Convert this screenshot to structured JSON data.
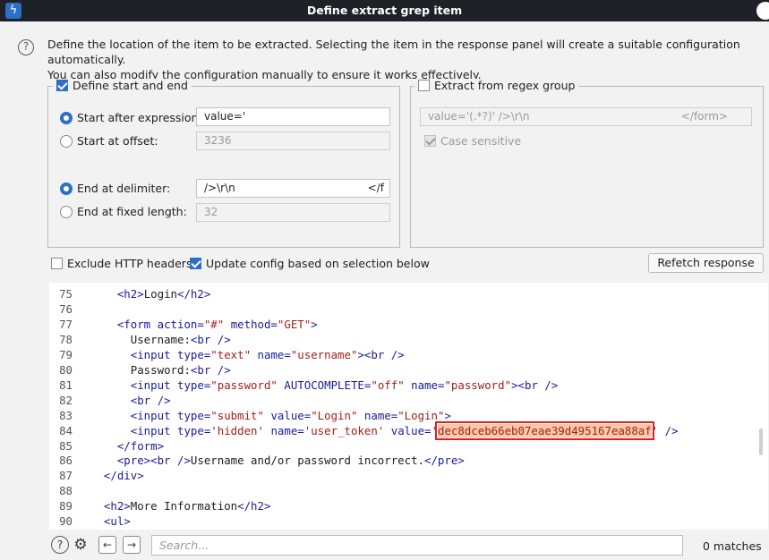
{
  "window": {
    "title": "Define extract grep item"
  },
  "intro": {
    "line1": "Define the location of the item to be extracted. Selecting the item in the response panel will create a suitable configuration automatically.",
    "line2": "You can also modify the configuration manually to ensure it works effectively."
  },
  "start_end": {
    "label": "Define start and end",
    "checked": true,
    "start_after_label": "Start after expression:",
    "start_after_value": "value='",
    "start_offset_label": "Start at offset:",
    "start_offset_value": "3236",
    "end_delim_label": "End at delimiter:",
    "end_delim_value": "/>\\r\\n",
    "end_delim_overflow": "</f",
    "end_fixed_label": "End at fixed length:",
    "end_fixed_value": "32"
  },
  "regex": {
    "label": "Extract from regex group",
    "checked": false,
    "value": "value='(.*?)' />\\r\\n",
    "value_overflow": "</form>",
    "case_label": "Case sensitive"
  },
  "options": {
    "exclude_headers": "Exclude HTTP headers",
    "update_config": "Update config based on selection below",
    "refetch": "Refetch response"
  },
  "code": {
    "lines": [
      {
        "n": "75",
        "ind": "    ",
        "t": [
          [
            "tag",
            "<h2>"
          ],
          [
            "txt",
            "Login"
          ],
          [
            "tag",
            "</h2>"
          ]
        ]
      },
      {
        "n": "76",
        "ind": "",
        "t": []
      },
      {
        "n": "77",
        "ind": "    ",
        "t": [
          [
            "tag",
            "<form "
          ],
          [
            "attr",
            "action="
          ],
          [
            "val",
            "\"#\""
          ],
          [
            "txt",
            " "
          ],
          [
            "attr",
            "method="
          ],
          [
            "val",
            "\"GET\""
          ],
          [
            "tag",
            ">"
          ]
        ]
      },
      {
        "n": "78",
        "ind": "      ",
        "t": [
          [
            "txt",
            "Username:"
          ],
          [
            "tag",
            "<br />"
          ]
        ]
      },
      {
        "n": "79",
        "ind": "      ",
        "t": [
          [
            "tag",
            "<input "
          ],
          [
            "attr",
            "type="
          ],
          [
            "val",
            "\"text\""
          ],
          [
            "txt",
            " "
          ],
          [
            "attr",
            "name="
          ],
          [
            "val",
            "\"username\""
          ],
          [
            "tag",
            "><br />"
          ]
        ]
      },
      {
        "n": "80",
        "ind": "      ",
        "t": [
          [
            "txt",
            "Password:"
          ],
          [
            "tag",
            "<br />"
          ]
        ]
      },
      {
        "n": "81",
        "ind": "      ",
        "t": [
          [
            "tag",
            "<input "
          ],
          [
            "attr",
            "type="
          ],
          [
            "val",
            "\"password\""
          ],
          [
            "txt",
            " "
          ],
          [
            "attr",
            "AUTOCOMPLETE="
          ],
          [
            "val",
            "\"off\""
          ],
          [
            "txt",
            " "
          ],
          [
            "attr",
            "name="
          ],
          [
            "val",
            "\"password\""
          ],
          [
            "tag",
            "><br />"
          ]
        ]
      },
      {
        "n": "82",
        "ind": "      ",
        "t": [
          [
            "tag",
            "<br />"
          ]
        ]
      },
      {
        "n": "83",
        "ind": "      ",
        "t": [
          [
            "tag",
            "<input "
          ],
          [
            "attr",
            "type="
          ],
          [
            "val",
            "\"submit\""
          ],
          [
            "txt",
            " "
          ],
          [
            "attr",
            "value="
          ],
          [
            "val",
            "\"Login\""
          ],
          [
            "txt",
            " "
          ],
          [
            "attr",
            "name="
          ],
          [
            "val",
            "\"Login\""
          ],
          [
            "tag",
            ">"
          ]
        ]
      },
      {
        "n": "84",
        "ind": "      ",
        "t": [
          [
            "tag",
            "<input "
          ],
          [
            "attr",
            "type="
          ],
          [
            "val",
            "'hidden'"
          ],
          [
            "txt",
            " "
          ],
          [
            "attr",
            "name="
          ],
          [
            "val",
            "'user_token'"
          ],
          [
            "txt",
            " "
          ],
          [
            "attr",
            "value="
          ],
          [
            "val",
            "'"
          ],
          [
            "hl",
            "dec8dceb66eb07eae39d495167ea88af"
          ],
          [
            "val",
            "'"
          ],
          [
            "tag",
            " />"
          ]
        ]
      },
      {
        "n": "85",
        "ind": "    ",
        "t": [
          [
            "tag",
            "</form>"
          ]
        ]
      },
      {
        "n": "86",
        "ind": "    ",
        "t": [
          [
            "tag",
            "<pre><br />"
          ],
          [
            "txt",
            "Username and/or password incorrect."
          ],
          [
            "tag",
            "</pre>"
          ]
        ]
      },
      {
        "n": "87",
        "ind": "  ",
        "t": [
          [
            "tag",
            "</div>"
          ]
        ]
      },
      {
        "n": "88",
        "ind": "",
        "t": []
      },
      {
        "n": "89",
        "ind": "  ",
        "t": [
          [
            "tag",
            "<h2>"
          ],
          [
            "txt",
            "More Information"
          ],
          [
            "tag",
            "</h2>"
          ]
        ]
      },
      {
        "n": "90",
        "ind": "  ",
        "t": [
          [
            "tag",
            "<ul>"
          ]
        ]
      }
    ]
  },
  "footer": {
    "search_placeholder": "Search...",
    "matches": "0 matches"
  },
  "colors": {
    "accent": "#2d6fc6",
    "highlight_border": "#e02020",
    "title_bar": "#1e2127"
  },
  "icons": {
    "app": "burp-icon",
    "help": "help-icon",
    "settings": "gear-icon",
    "prev": "arrow-left-icon",
    "next": "arrow-right-icon"
  }
}
